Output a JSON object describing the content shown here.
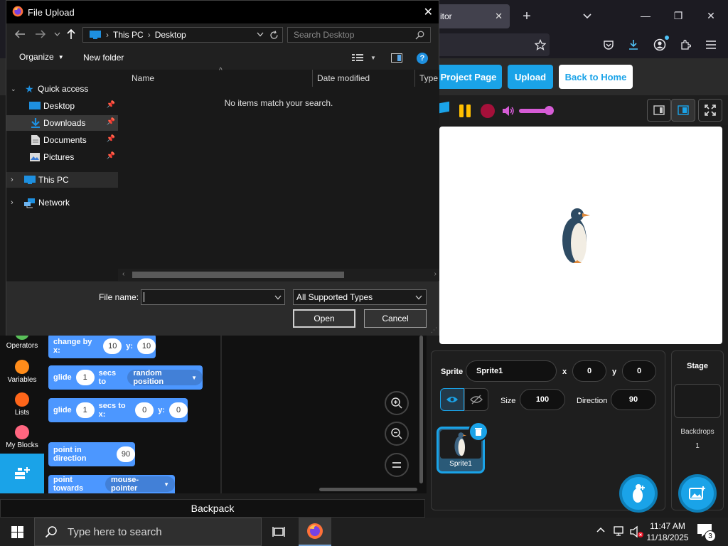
{
  "browser": {
    "tab_title": "itor",
    "new_tab_symbol": "+"
  },
  "scratch": {
    "header_buttons": [
      "Project Page",
      "Upload",
      "Back to Home"
    ],
    "colors": {
      "accent": "#1aa3e8",
      "block": "#4c97ff",
      "operators": "#59c059",
      "variables": "#ff8c1a",
      "lists": "#ff661a",
      "my_blocks": "#ff6680"
    },
    "categories": [
      "Operators",
      "Variables",
      "Lists",
      "My Blocks"
    ],
    "blocks": {
      "change_by": {
        "label": "change by x:",
        "x": "10",
        "y_label": "y:",
        "y": "10"
      },
      "glide_random": {
        "label": "glide",
        "secs": "1",
        "secs_label": "secs to",
        "target": "random position"
      },
      "glide_xy": {
        "label": "glide",
        "secs": "1",
        "secs_label": "secs to x:",
        "x": "0",
        "y_label": "y:",
        "y": "0"
      },
      "point_direction": {
        "label": "point in direction",
        "value": "90"
      },
      "point_towards": {
        "label": "point towards",
        "target": "mouse-pointer"
      }
    },
    "backpack": "Backpack",
    "sprite_info": {
      "sprite_label": "Sprite",
      "sprite_name": "Sprite1",
      "x_label": "x",
      "x": "0",
      "y_label": "y",
      "y": "0",
      "size_label": "Size",
      "size": "100",
      "direction_label": "Direction",
      "direction": "90",
      "thumb_name": "Sprite1"
    },
    "stage_panel": {
      "title": "Stage",
      "backdrops_label": "Backdrops",
      "backdrops_count": "1"
    }
  },
  "dialog": {
    "title": "File Upload",
    "address": [
      "This PC",
      "Desktop"
    ],
    "search_placeholder": "Search Desktop",
    "organize": "Organize",
    "new_folder": "New folder",
    "nav": {
      "quick_access": "Quick access",
      "items": [
        "Desktop",
        "Downloads",
        "Documents",
        "Pictures"
      ],
      "this_pc": "This PC",
      "network": "Network"
    },
    "columns": [
      "Name",
      "Date modified",
      "Type"
    ],
    "empty_message": "No items match your search.",
    "file_name_label": "File name:",
    "file_name_value": "",
    "file_type": "All Supported Types",
    "open": "Open",
    "cancel": "Cancel"
  },
  "taskbar": {
    "search_placeholder": "Type here to search",
    "time": "11:47 AM",
    "date": "11/18/2025",
    "notifications": "3"
  }
}
